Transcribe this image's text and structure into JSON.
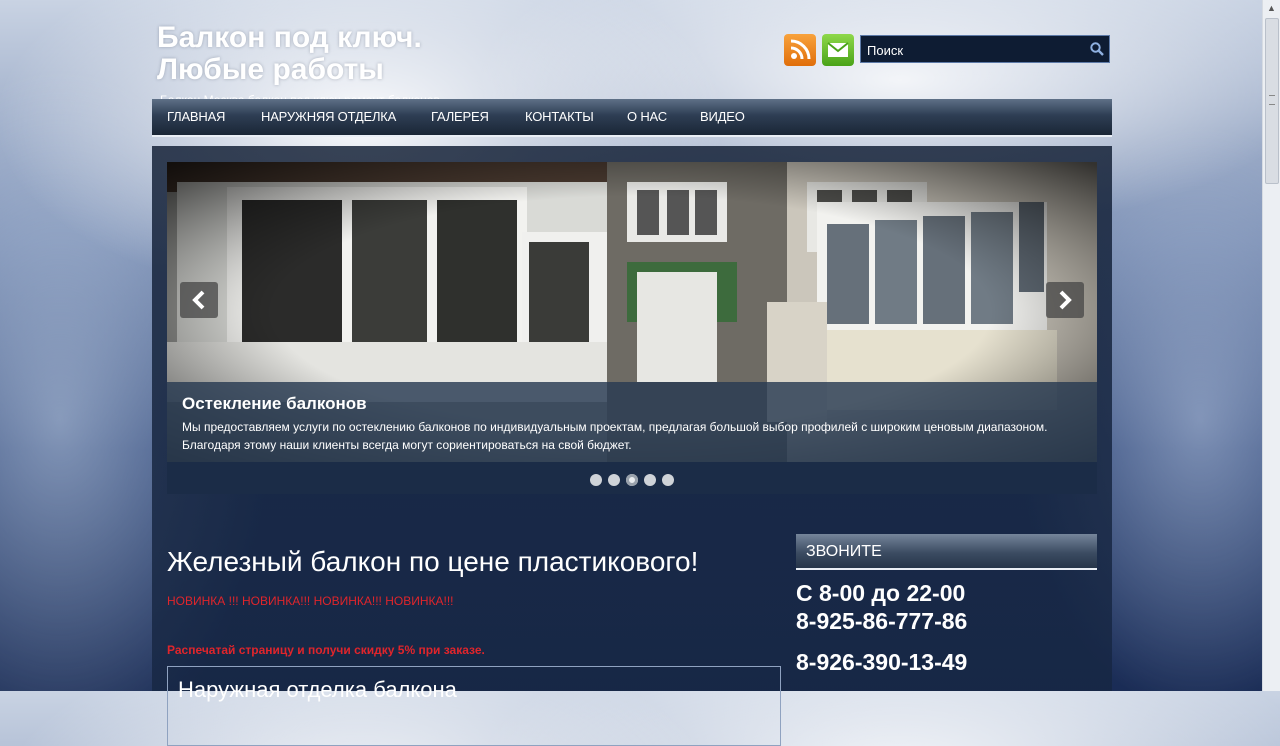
{
  "header": {
    "title_line1": "Балкон под ключ.",
    "title_line2": "Любые работы",
    "tagline": "Балкон Москва балкон под ключ ремонт балконов"
  },
  "icons": {
    "rss": "rss-icon",
    "mail": "mail-icon",
    "search": "search-icon",
    "prev": "chevron-left-icon",
    "next": "chevron-right-icon"
  },
  "search": {
    "placeholder": "Поиск"
  },
  "nav": {
    "items": [
      {
        "label": "ГЛАВНАЯ"
      },
      {
        "label": "НАРУЖНЯЯ ОТДЕЛКА"
      },
      {
        "label": "ГАЛЕРЕЯ"
      },
      {
        "label": "КОНТАКТЫ"
      },
      {
        "label": "О НАС"
      },
      {
        "label": "ВИДЕО"
      }
    ]
  },
  "slider": {
    "caption_title": "Остекление балконов",
    "caption_text": "Мы предоставляем услуги по остеклению балконов по индивидуальным проектам, предлагая большой выбор профилей с широким ценовым диапазоном. Благодаря этому наши клиенты всегда могут сориентироваться на свой бюджет.",
    "slide_count": 5,
    "active_slide": 3
  },
  "main": {
    "post_title": "Железный балкон по цене пластикового!",
    "promo_new": "НОВИНКА !!! НОВИНКА!!! НОВИНКА!!! НОВИНКА!!!",
    "promo_discount": "Распечатай страницу и получи скидку 5% при заказе.",
    "section_heading": "Наружная отделка балкона"
  },
  "sidebar": {
    "widget_title": "ЗВОНИТЕ",
    "hours": "С 8-00 до 22-00",
    "phone1": "8-925-86-777-86",
    "phone2": "8-926-390-13-49"
  },
  "colors": {
    "accent_red": "#e0252b",
    "rss_orange": "#f08a24",
    "mail_green": "#6bbf2e",
    "search_bg": "#0e1c33"
  }
}
